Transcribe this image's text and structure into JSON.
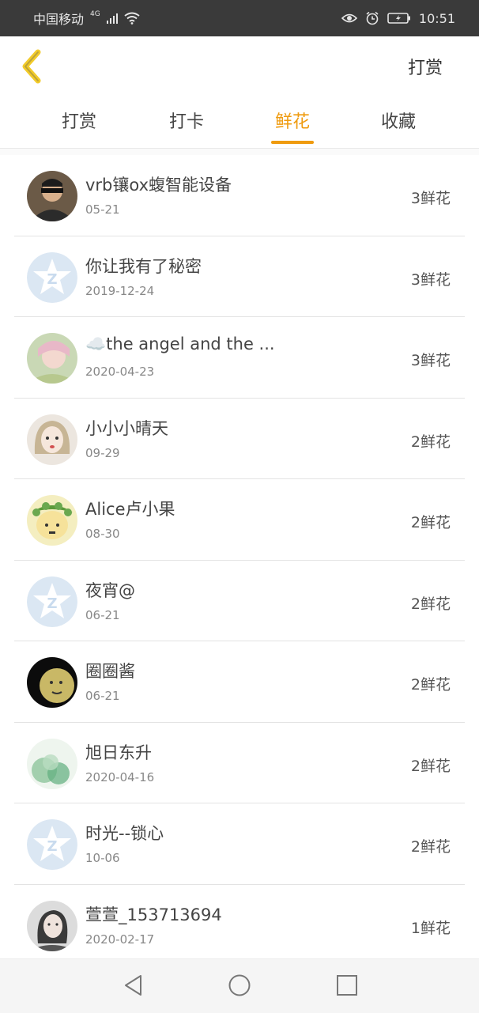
{
  "status_bar": {
    "carrier": "中国移动",
    "network": "4G",
    "time": "10:51"
  },
  "header": {
    "back_icon": "chevron-left-icon",
    "action_label": "打赏",
    "accent_color": "#ef9b0f"
  },
  "tabs": [
    {
      "label": "打赏",
      "active": false
    },
    {
      "label": "打卡",
      "active": false
    },
    {
      "label": "鲜花",
      "active": true
    },
    {
      "label": "收藏",
      "active": false
    }
  ],
  "list": [
    {
      "name": "vrb镶ox蝮智能设备",
      "date": "05-21",
      "count": "3鲜花",
      "avatar": "photo"
    },
    {
      "name": "你让我有了秘密",
      "date": "2019-12-24",
      "count": "3鲜花",
      "avatar": "default"
    },
    {
      "name": "☁️the angel and the ...",
      "date": "2020-04-23",
      "count": "3鲜花",
      "avatar": "photo"
    },
    {
      "name": "小小小晴天",
      "date": "09-29",
      "count": "2鲜花",
      "avatar": "photo"
    },
    {
      "name": "Alice卢小果",
      "date": "08-30",
      "count": "2鲜花",
      "avatar": "photo"
    },
    {
      "name": "夜宵@",
      "date": "06-21",
      "count": "2鲜花",
      "avatar": "default"
    },
    {
      "name": "圈圈酱",
      "date": "06-21",
      "count": "2鲜花",
      "avatar": "photo"
    },
    {
      "name": "旭日东升",
      "date": "2020-04-16",
      "count": "2鲜花",
      "avatar": "photo"
    },
    {
      "name": "时光--锁心",
      "date": "10-06",
      "count": "2鲜花",
      "avatar": "default"
    },
    {
      "name": "萱萱_153713694",
      "date": "2020-02-17",
      "count": "1鲜花",
      "avatar": "photo"
    }
  ],
  "nav_bar": {
    "back": "triangle-back-icon",
    "home": "circle-home-icon",
    "recents": "square-recents-icon"
  }
}
